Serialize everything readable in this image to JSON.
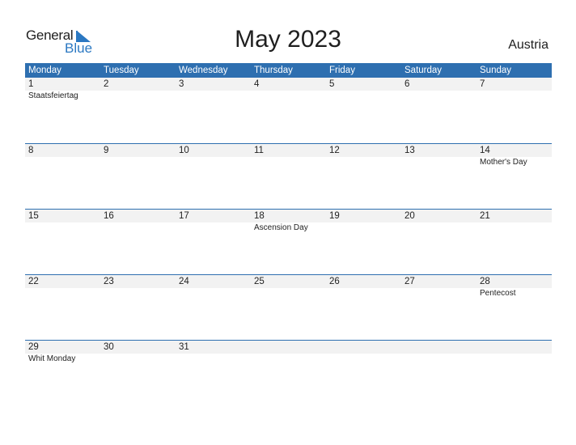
{
  "brand": {
    "line1": "General",
    "line2": "Blue",
    "accent": "#2b78c2"
  },
  "title": "May 2023",
  "country": "Austria",
  "colors": {
    "header_bg": "#2e6fb0",
    "daynum_bg": "#f2f2f2"
  },
  "weekdays": [
    "Monday",
    "Tuesday",
    "Wednesday",
    "Thursday",
    "Friday",
    "Saturday",
    "Sunday"
  ],
  "weeks": [
    {
      "days": [
        "1",
        "2",
        "3",
        "4",
        "5",
        "6",
        "7"
      ],
      "events": [
        "Staatsfeiertag",
        "",
        "",
        "",
        "",
        "",
        ""
      ]
    },
    {
      "days": [
        "8",
        "9",
        "10",
        "11",
        "12",
        "13",
        "14"
      ],
      "events": [
        "",
        "",
        "",
        "",
        "",
        "",
        "Mother's Day"
      ]
    },
    {
      "days": [
        "15",
        "16",
        "17",
        "18",
        "19",
        "20",
        "21"
      ],
      "events": [
        "",
        "",
        "",
        "Ascension Day",
        "",
        "",
        ""
      ]
    },
    {
      "days": [
        "22",
        "23",
        "24",
        "25",
        "26",
        "27",
        "28"
      ],
      "events": [
        "",
        "",
        "",
        "",
        "",
        "",
        "Pentecost"
      ]
    },
    {
      "days": [
        "29",
        "30",
        "31",
        "",
        "",
        "",
        ""
      ],
      "events": [
        "Whit Monday",
        "",
        "",
        "",
        "",
        "",
        ""
      ]
    }
  ]
}
